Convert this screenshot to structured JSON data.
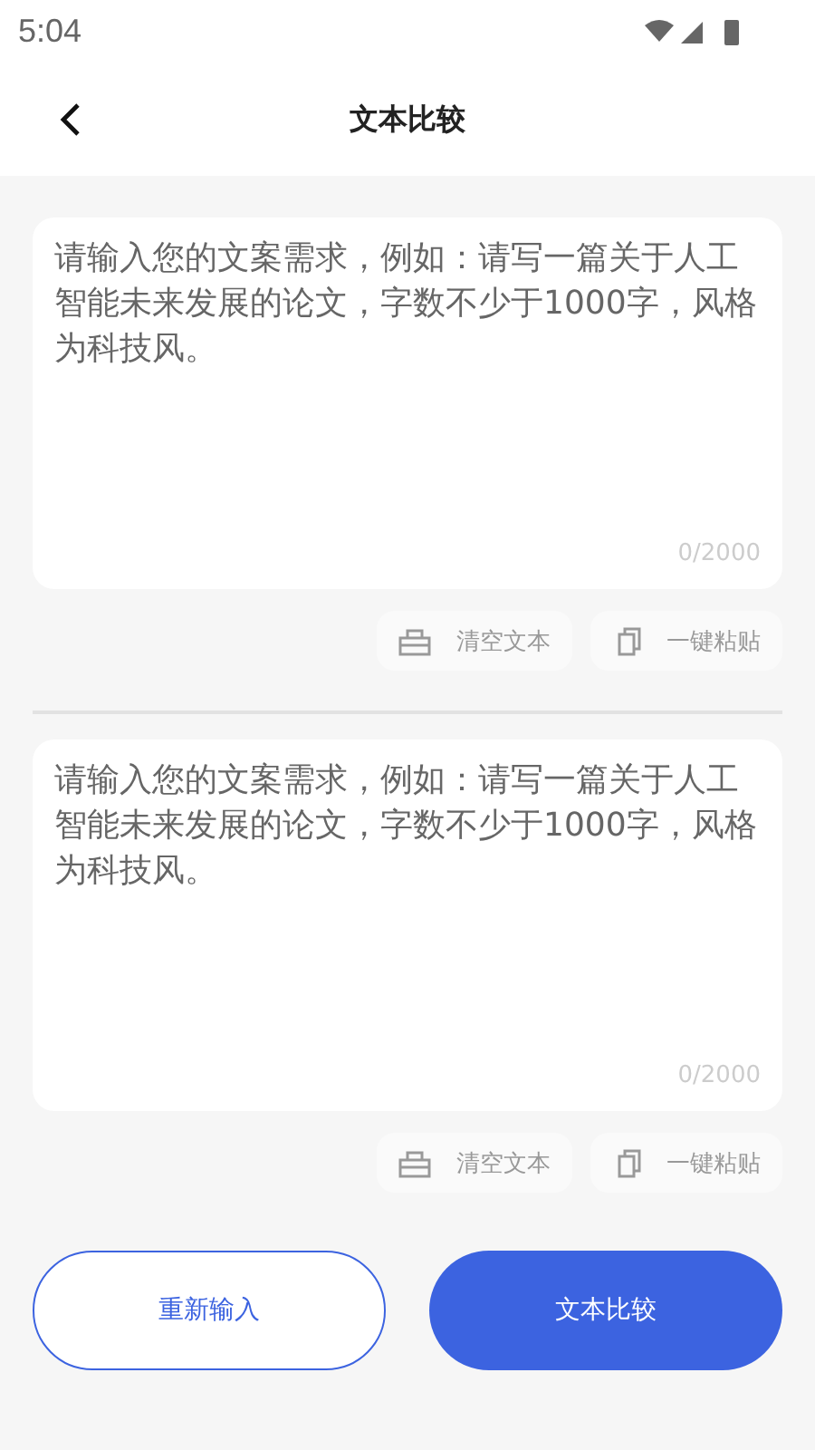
{
  "status_bar": {
    "time": "5:04"
  },
  "header": {
    "title": "文本比较"
  },
  "editors": [
    {
      "placeholder": "请输入您的文案需求，例如：请写一篇关于人工智能未来发展的论文，字数不少于1000字，风格为科技风。",
      "counter": "0/2000",
      "actions": [
        {
          "kind": "clear",
          "label": "清空文本",
          "disabled": true
        },
        {
          "kind": "paste",
          "label": "一键粘贴",
          "disabled": true
        }
      ]
    },
    {
      "placeholder": "请输入您的文案需求，例如：请写一篇关于人工智能未来发展的论文，字数不少于1000字，风格为科技风。",
      "counter": "0/2000",
      "actions": [
        {
          "kind": "clear",
          "label": "清空文本",
          "disabled": true
        },
        {
          "kind": "paste",
          "label": "一键粘贴",
          "disabled": true
        }
      ]
    }
  ],
  "footer": [
    {
      "label": "重新输入",
      "kind": "outline"
    },
    {
      "label": "文本比较",
      "kind": "primary"
    }
  ]
}
